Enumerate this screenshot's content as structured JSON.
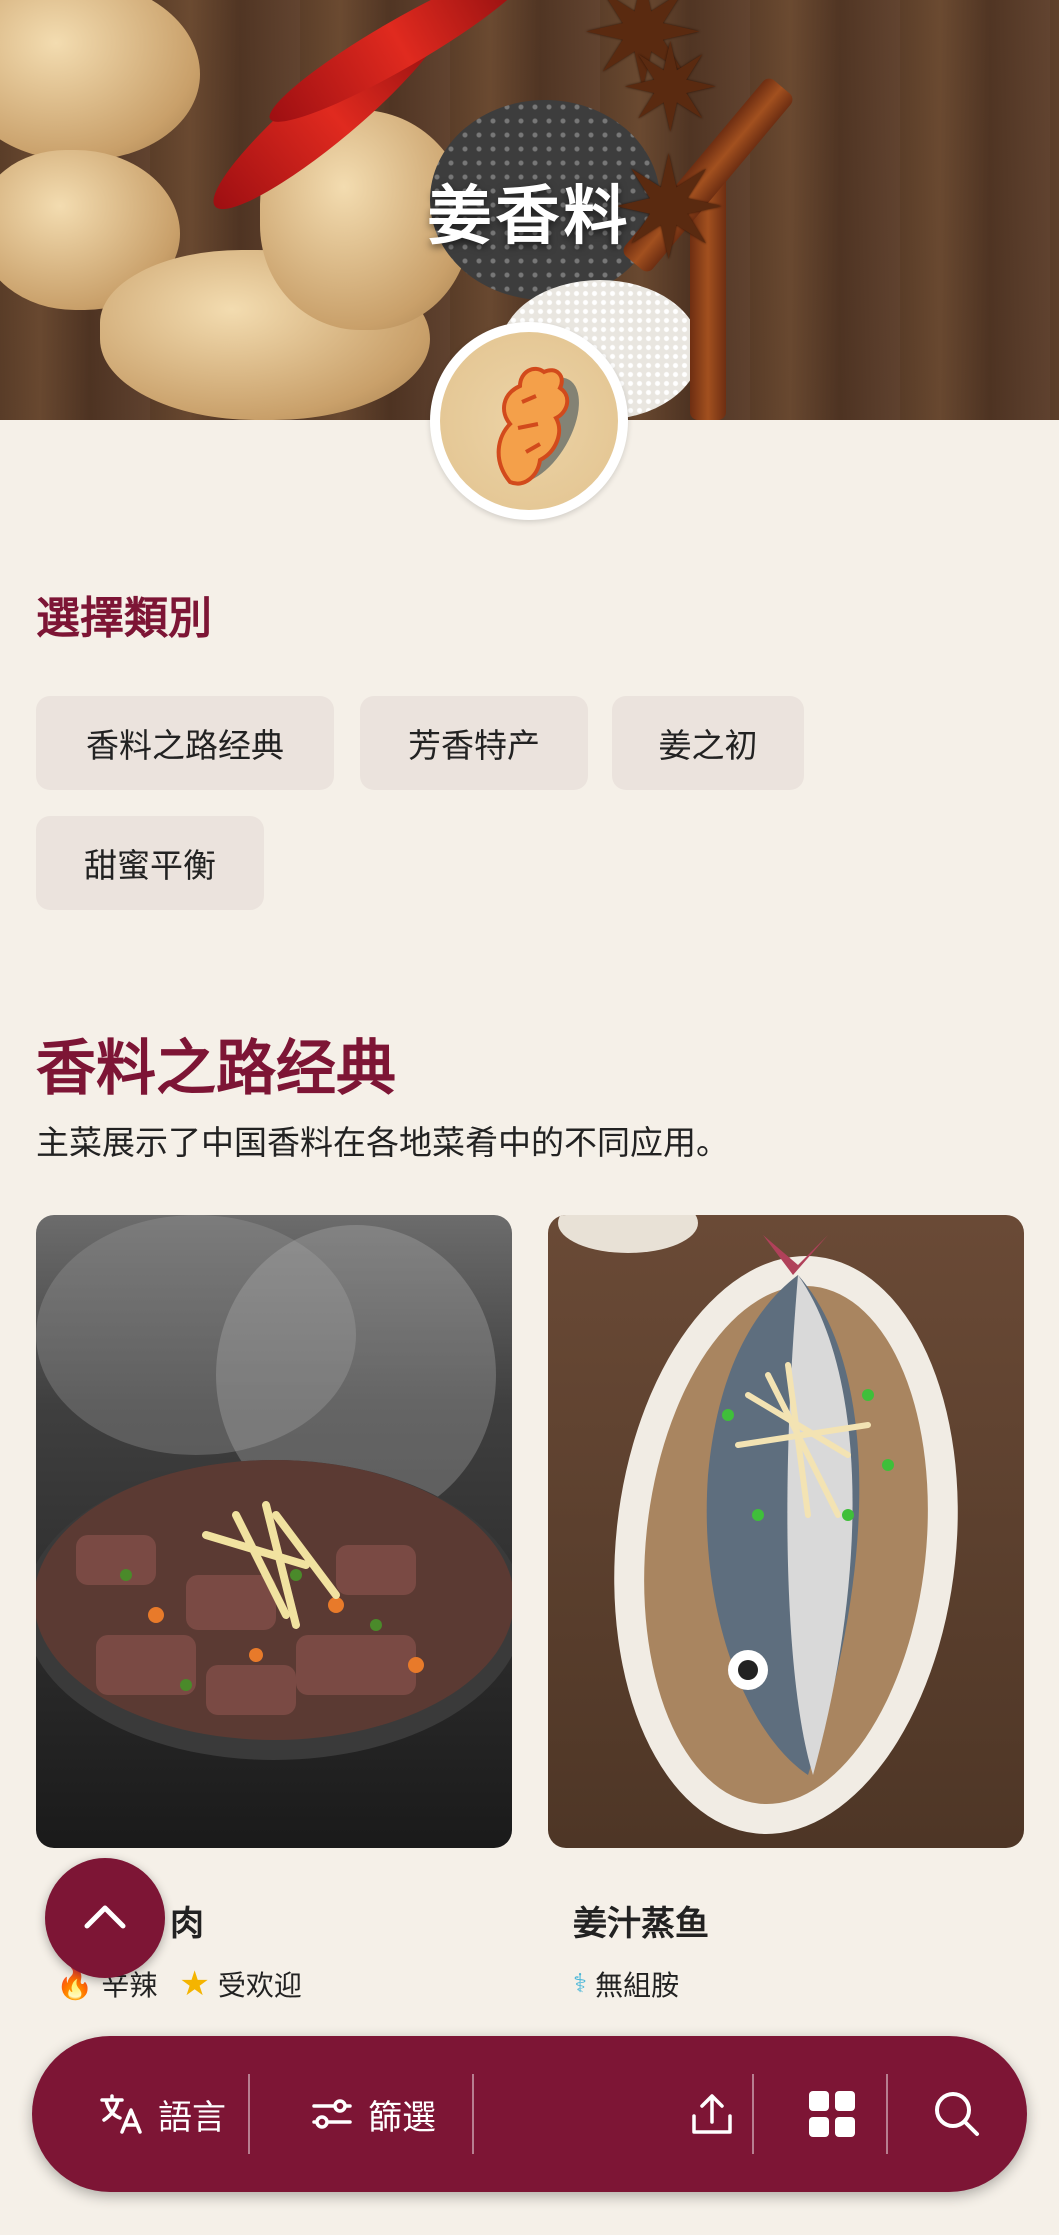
{
  "hero": {
    "title": "姜香料"
  },
  "categories": {
    "label": "選擇類別",
    "chips": [
      "香料之路经典",
      "芳香特产",
      "姜之初",
      "甜蜜平衡"
    ]
  },
  "category": {
    "title": "香料之路经典",
    "description": "主菜展示了中国香料在各地菜肴中的不同应用。"
  },
  "dishes": [
    {
      "name": "肉",
      "tags": [
        "辛辣",
        "受欢迎"
      ]
    },
    {
      "name": "姜汁蒸鱼",
      "tags": [
        "無組胺"
      ]
    }
  ],
  "bottom_bar": {
    "language_label": "語言",
    "filter_label": "篩選"
  },
  "colors": {
    "brand": "#7d1535",
    "background": "#f5f0e8",
    "chip": "#ebe3dd"
  }
}
